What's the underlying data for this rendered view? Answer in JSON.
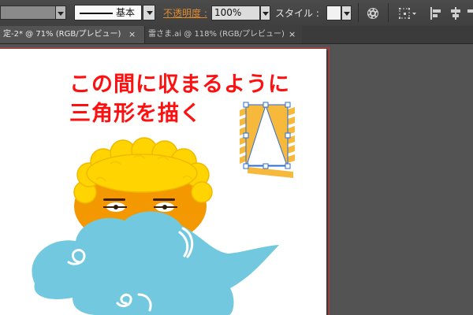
{
  "control_bar": {
    "stroke_profile_label": "基本",
    "opacity_label": "不透明度 :",
    "opacity_value": "100%",
    "style_label": "スタイル :"
  },
  "tabs": [
    {
      "label": "定-2* @ 71% (RGB/プレビュー)",
      "close": "×",
      "active": true
    },
    {
      "label": "雷さま.ai @ 118% (RGB/プレビュー)",
      "close": "×",
      "active": false
    }
  ],
  "canvas": {
    "instruction_line1": "この間に収まるように",
    "instruction_line2": "三角形を描く"
  },
  "colors": {
    "accent_red": "#ff1010",
    "cloud_blue": "#72c9df",
    "hair_yellow": "#ffd400",
    "face_orange": "#f39800",
    "stripe_yellow": "#f6b93b",
    "selection_blue": "#2a6dd9"
  }
}
